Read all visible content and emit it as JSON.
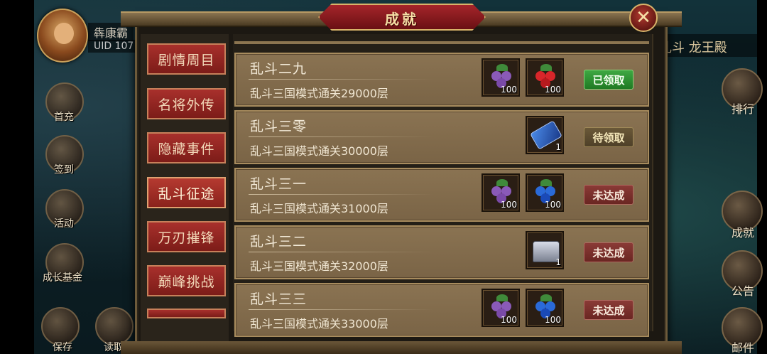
{
  "player": {
    "name": "犇康霸",
    "uid": "UID  107"
  },
  "left_menu": [
    {
      "label": "首充",
      "icon": "gift-icon"
    },
    {
      "label": "签到",
      "icon": "calendar-icon"
    },
    {
      "label": "活动",
      "icon": "event-icon"
    },
    {
      "label": "成长基金",
      "icon": "growth-fund-icon"
    }
  ],
  "bottom_left": [
    {
      "label": "保存",
      "icon": "save-icon"
    },
    {
      "label": "读取",
      "icon": "load-icon"
    }
  ],
  "right_header": "乱斗 龙王殿",
  "right_menu": [
    {
      "label": "排行",
      "icon": "ranking-icon"
    },
    {
      "label": "成就",
      "icon": "achievement-icon"
    },
    {
      "label": "公告",
      "icon": "notice-icon"
    },
    {
      "label": "邮件",
      "icon": "mail-icon"
    }
  ],
  "dialog": {
    "title": "成就",
    "close_symbol": "✕"
  },
  "tabs": [
    {
      "label": "剧情周目",
      "active": false
    },
    {
      "label": "名将外传",
      "active": false
    },
    {
      "label": "隐藏事件",
      "active": false
    },
    {
      "label": "乱斗征途",
      "active": true
    },
    {
      "label": "万刃摧锋",
      "active": false
    },
    {
      "label": "巅峰挑战",
      "active": false
    }
  ],
  "achievements": [
    {
      "title": "乱斗二九",
      "desc": "乱斗三国模式通关29000层",
      "rewards": [
        {
          "type": "purple-fruit",
          "count": "100"
        },
        {
          "type": "red-fruit",
          "count": "100"
        }
      ],
      "status": "已领取",
      "status_kind": "claimed"
    },
    {
      "title": "乱斗三零",
      "desc": "乱斗三国模式通关30000层",
      "rewards": [
        {
          "type": "blue-scroll",
          "count": "1"
        }
      ],
      "status": "待领取",
      "status_kind": "pending"
    },
    {
      "title": "乱斗三一",
      "desc": "乱斗三国模式通关31000层",
      "rewards": [
        {
          "type": "purple-fruit",
          "count": "100"
        },
        {
          "type": "blue-fruit",
          "count": "100"
        }
      ],
      "status": "未达成",
      "status_kind": "unmet"
    },
    {
      "title": "乱斗三二",
      "desc": "乱斗三国模式通关32000层",
      "rewards": [
        {
          "type": "silver-chest",
          "count": "1"
        }
      ],
      "status": "未达成",
      "status_kind": "unmet"
    },
    {
      "title": "乱斗三三",
      "desc": "乱斗三国模式通关33000层",
      "rewards": [
        {
          "type": "purple-fruit",
          "count": "100"
        },
        {
          "type": "blue-fruit",
          "count": "100"
        }
      ],
      "status": "未达成",
      "status_kind": "unmet"
    }
  ],
  "colors": {
    "claimed": "#2f9a34",
    "pending": "#5e4c30",
    "unmet": "#7c302c",
    "purple-fruit": "#8a5ab8",
    "red-fruit": "#d8262a",
    "blue-fruit": "#2a6ad8"
  }
}
